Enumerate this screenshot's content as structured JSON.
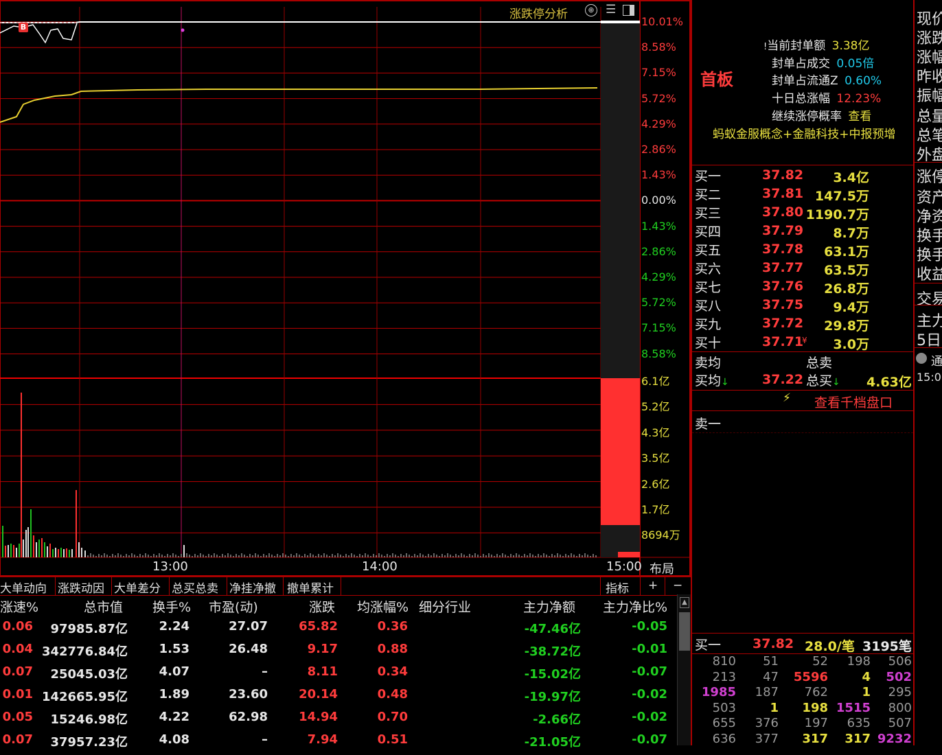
{
  "chart_header": {
    "title": "涨跌停分析"
  },
  "chart": {
    "price_axis": [
      "10.01%",
      "8.58%",
      "7.15%",
      "5.72%",
      "4.29%",
      "2.86%",
      "1.43%",
      "0.00%",
      "1.43%",
      "2.86%",
      "4.29%",
      "5.72%",
      "7.15%",
      "8.58%"
    ],
    "volume_axis": [
      "6.1亿",
      "5.2亿",
      "4.3亿",
      "3.5亿",
      "2.6亿",
      "1.7亿",
      "8694万"
    ],
    "time_axis": [
      "13:00",
      "14:00",
      "15:00"
    ],
    "marker": "B",
    "layout_button": "布局"
  },
  "tabs": [
    "大单动向",
    "涨跌动因",
    "大单差分",
    "总买总卖",
    "净挂净撤",
    "撤单累计"
  ],
  "tab_right": {
    "indicator": "指标",
    "plus": "+",
    "minus": "−"
  },
  "table": {
    "headers": [
      "涨速%",
      "总市值",
      "换手%",
      "市盈(动)",
      "涨跌",
      "均涨幅%",
      "细分行业",
      "主力净额",
      "主力净比%"
    ],
    "rows": [
      [
        "0.06",
        "97985.87亿",
        "2.24",
        "27.07",
        "65.82",
        "0.36",
        "",
        "-47.46亿",
        "-0.05"
      ],
      [
        "0.04",
        "342776.84亿",
        "1.53",
        "26.48",
        "9.17",
        "0.88",
        "",
        "-38.72亿",
        "-0.01"
      ],
      [
        "0.07",
        "25045.03亿",
        "4.07",
        "–",
        "8.11",
        "0.34",
        "",
        "-15.02亿",
        "-0.07"
      ],
      [
        "0.01",
        "142665.95亿",
        "1.89",
        "23.60",
        "20.14",
        "0.48",
        "",
        "-19.97亿",
        "-0.02"
      ],
      [
        "0.05",
        "15246.98亿",
        "4.22",
        "62.98",
        "14.94",
        "0.70",
        "",
        "-2.66亿",
        "-0.02"
      ],
      [
        "0.07",
        "37957.23亿",
        "4.08",
        "–",
        "7.94",
        "0.51",
        "",
        "-21.05亿",
        "-0.07"
      ]
    ]
  },
  "info": {
    "board": "首板",
    "lines": [
      {
        "label": "当前封单额",
        "value": "3.38亿"
      },
      {
        "label": "封单占成交",
        "value": "0.05倍"
      },
      {
        "label": "封单占流通Z",
        "value": "0.60%"
      },
      {
        "label": "十日总涨幅",
        "value": "12.23%"
      },
      {
        "label": "继续涨停概率",
        "value": "查看"
      }
    ],
    "concepts": "蚂蚁金服概念+金融科技+中报预增"
  },
  "orderbook": {
    "bids": [
      {
        "label": "买一",
        "price": "37.82",
        "vol": "3.4亿"
      },
      {
        "label": "买二",
        "price": "37.81",
        "vol": "147.5万"
      },
      {
        "label": "买三",
        "price": "37.80",
        "vol": "1190.7万"
      },
      {
        "label": "买四",
        "price": "37.79",
        "vol": "8.7万"
      },
      {
        "label": "买五",
        "price": "37.78",
        "vol": "63.1万"
      },
      {
        "label": "买六",
        "price": "37.77",
        "vol": "63.5万"
      },
      {
        "label": "买七",
        "price": "37.76",
        "vol": "26.8万"
      },
      {
        "label": "买八",
        "price": "37.75",
        "vol": "9.4万"
      },
      {
        "label": "买九",
        "price": "37.72",
        "vol": "29.8万"
      },
      {
        "label": "买十",
        "price": "37.71",
        "vol": "3.0万"
      }
    ],
    "sell_avg_label": "卖均",
    "total_sell_label": "总卖",
    "buy_avg_label": "买均",
    "buy_avg": "37.22",
    "total_buy_label": "总买",
    "total_buy": "4.63亿",
    "view_depth": "查看千档盘口",
    "sell1": "卖一"
  },
  "queue": {
    "label": "买一",
    "price": "37.82",
    "per": "28.0/笔",
    "count": "3195笔",
    "rows": [
      [
        "810",
        "51",
        "52",
        "198",
        "506"
      ],
      [
        "213",
        "47",
        "5596",
        "4",
        "502"
      ],
      [
        "1985",
        "187",
        "762",
        "1",
        "295"
      ],
      [
        "503",
        "1",
        "198",
        "1515",
        "800"
      ],
      [
        "655",
        "376",
        "197",
        "635",
        "507"
      ],
      [
        "636",
        "377",
        "317",
        "317",
        "9232"
      ]
    ]
  },
  "far_right": [
    "现价",
    "涨跌",
    "涨幅",
    "昨收",
    "振幅",
    "总量",
    "总笔",
    "外盘",
    "涨停",
    "资产",
    "净资",
    "换手",
    "换手",
    "收益",
    "交易",
    "主力",
    "5日",
    "通",
    "15:00"
  ]
}
